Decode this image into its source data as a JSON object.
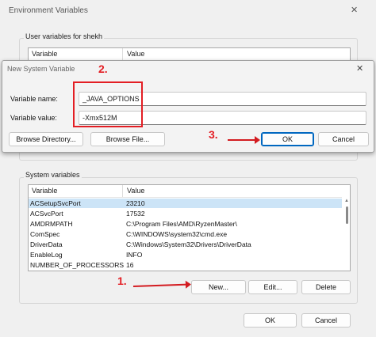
{
  "env_window": {
    "title": "Environment Variables",
    "close_glyph": "✕",
    "user_group": {
      "label": "User variables for shekh",
      "columns": [
        "Variable",
        "Value"
      ]
    },
    "system_group": {
      "label": "System variables",
      "columns": [
        "Variable",
        "Value"
      ],
      "rows": [
        {
          "variable": "ACSetupSvcPort",
          "value": "23210"
        },
        {
          "variable": "ACSvcPort",
          "value": "17532"
        },
        {
          "variable": "AMDRMPATH",
          "value": "C:\\Program Files\\AMD\\RyzenMaster\\"
        },
        {
          "variable": "ComSpec",
          "value": "C:\\WINDOWS\\system32\\cmd.exe"
        },
        {
          "variable": "DriverData",
          "value": "C:\\Windows\\System32\\Drivers\\DriverData"
        },
        {
          "variable": "EnableLog",
          "value": "INFO"
        },
        {
          "variable": "NUMBER_OF_PROCESSORS",
          "value": "16"
        }
      ],
      "buttons": {
        "new": "New...",
        "edit": "Edit...",
        "delete": "Delete"
      }
    },
    "buttons": {
      "ok": "OK",
      "cancel": "Cancel"
    }
  },
  "new_var_dialog": {
    "title": "New System Variable",
    "close_glyph": "✕",
    "name_label": "Variable name:",
    "name_value": "_JAVA_OPTIONS",
    "value_label": "Variable value:",
    "value_value": "-Xmx512M",
    "buttons": {
      "browse_dir": "Browse Directory...",
      "browse_file": "Browse File...",
      "ok": "OK",
      "cancel": "Cancel"
    }
  },
  "annotations": {
    "step1": "1.",
    "step2": "2.",
    "step3": "3.",
    "color": "#e31e24"
  }
}
